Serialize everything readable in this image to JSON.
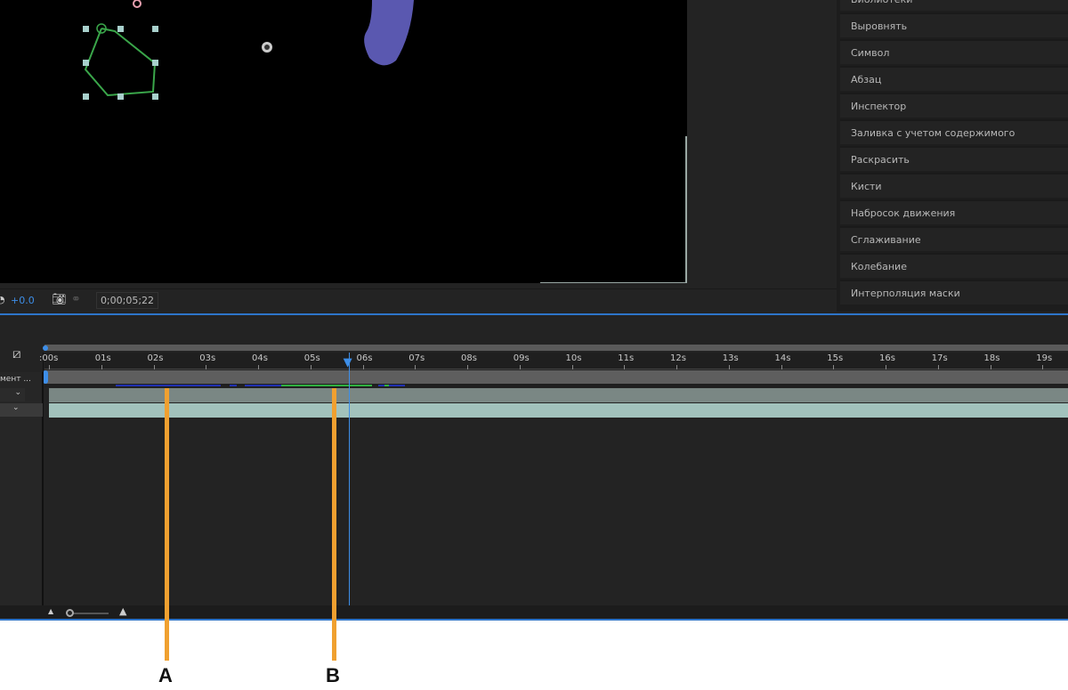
{
  "panel_items": [
    "Библиотеки",
    "Выровнять",
    "Символ",
    "Абзац",
    "Инспектор",
    "Заливка с учетом содержимого",
    "Раскрасить",
    "Кисти",
    "Набросок движения",
    "Сглаживание",
    "Колебание",
    "Интерполяция маски"
  ],
  "toolbar": {
    "exposure": "+0.0",
    "timecode": "0;00;05;22"
  },
  "timeline": {
    "layer_label": "мент ...",
    "ruler_labels": [
      ":00s",
      "01s",
      "02s",
      "03s",
      "04s",
      "05s",
      "06s",
      "07s",
      "08s",
      "09s",
      "10s",
      "11s",
      "12s",
      "13s",
      "14s",
      "15s",
      "16s",
      "17s",
      "18s",
      "19s"
    ],
    "playhead_seconds": 5.73
  },
  "annotations": {
    "a": "A",
    "b": "B"
  },
  "colors": {
    "accent": "#2d74c9",
    "annotation": "#f0a030",
    "mask": "#3aa64a"
  }
}
